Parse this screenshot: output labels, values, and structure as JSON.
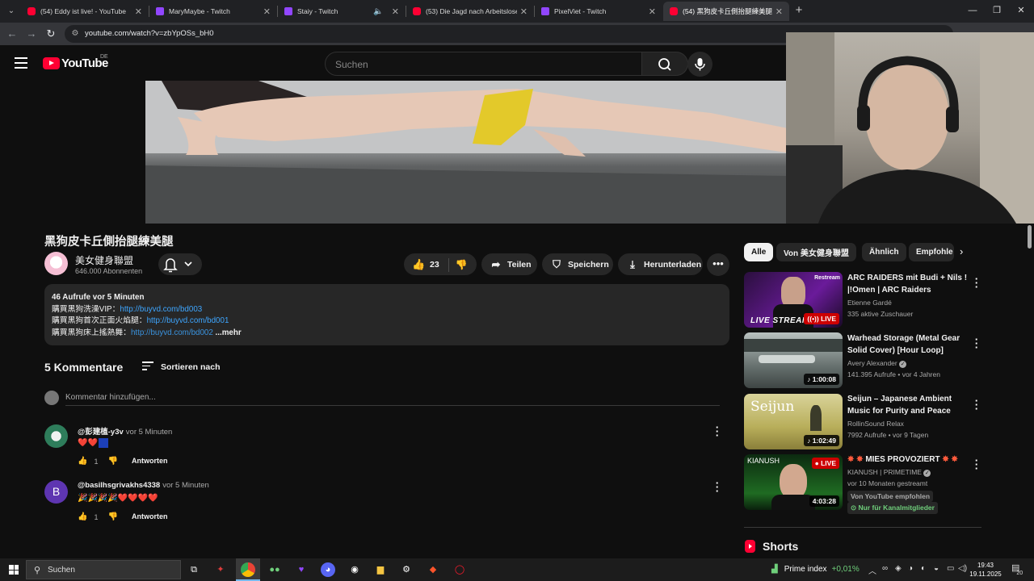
{
  "browser": {
    "tabs": [
      {
        "label": "(54) Eddy ist live! - YouTube",
        "type": "yt",
        "active": false
      },
      {
        "label": "MaryMaybe - Twitch",
        "type": "tw",
        "active": false
      },
      {
        "label": "Staiy - Twitch",
        "type": "tw",
        "active": false,
        "muted": true
      },
      {
        "label": "(53) Die Jagd nach Arbeitslosen",
        "type": "yt",
        "active": false
      },
      {
        "label": "PixelViet - Twitch",
        "type": "tw",
        "active": false
      },
      {
        "label": "(54) 黑狗皮卡丘側抬腿練美腿 -",
        "type": "yt",
        "active": true
      }
    ],
    "url": "youtube.com/watch?v=zbYpOSs_bH0"
  },
  "masthead": {
    "logo_text": "YouTube",
    "country": "DE",
    "search_placeholder": "Suchen"
  },
  "video": {
    "title": "黑狗皮卡丘側抬腿練美腿",
    "channel": "美女健身聯盟",
    "subscribers": "646.000 Abonnenten",
    "likes": "23",
    "share_label": "Teilen",
    "save_label": "Speichern",
    "download_label": "Herunterladen"
  },
  "description": {
    "meta": "46 Aufrufe  vor 5 Minuten",
    "lines": [
      {
        "text": "購買黑狗洗澡VIP：",
        "link": "http://buyvd.com/bd003"
      },
      {
        "text": "購買黑狗首次正面火焰腿：",
        "link": "http://buyvd.com/bd001"
      },
      {
        "text": "購買黑狗床上搖熱舞：",
        "link": "http://buyvd.com/bd002"
      }
    ],
    "more": "...mehr"
  },
  "comments": {
    "header": "5 Kommentare",
    "sort_label": "Sortieren nach",
    "add_placeholder": "Kommentar hinzufügen...",
    "reply_label": "Antworten",
    "items": [
      {
        "author": "@彭建植-y3v",
        "time": "vor 5 Minuten",
        "text": "❤️❤️",
        "likes": "1",
        "avatar_color": "#2e7d5b"
      },
      {
        "author": "@basilhsgrivakhs4338",
        "time": "vor 5 Minuten",
        "text": "🎉🎉🎉🎉❤️❤️❤️❤️",
        "likes": "1",
        "avatar_color": "#5e35b1",
        "avatar_letter": "B"
      }
    ]
  },
  "sidebar": {
    "chips": [
      "Alle",
      "Von 美女健身聯盟",
      "Ähnlich",
      "Empfohle"
    ],
    "recommendations": [
      {
        "title": "ARC RAIDERS mit Budi + Nils ! |!Omen | ARC Raiders",
        "channel": "Etienne Gardé",
        "meta": "335 aktive Zuschauer",
        "badge": "LIVE",
        "thumb_text": "LIVE STREAM",
        "restream": "Restream"
      },
      {
        "title": "Warhead Storage (Metal Gear Solid Cover) [Hour Loop]",
        "channel": "Avery Alexander",
        "meta": "141.395 Aufrufe • vor 4 Jahren",
        "badge": "1:00:08"
      },
      {
        "title": "Seijun – Japanese Ambient Music for Purity and Peace",
        "channel": "RollinSound Relax",
        "meta": "7992 Aufrufe • vor 9 Tagen",
        "badge": "1:02:49",
        "thumb_text": "Seijun"
      },
      {
        "title": "MIES PROVOZIERT",
        "channel": "KIANUSH | PRIMETIME",
        "meta": "vor 10 Monaten gestreamt",
        "badge": "4:03:28",
        "live_badge": "LIVE",
        "thumb_text": "KIANUSH",
        "tag1": "Von YouTube empfohlen",
        "tag2": "Nur für Kanalmitglieder"
      }
    ],
    "shorts_label": "Shorts"
  },
  "taskbar": {
    "search_label": "Suchen",
    "stock_name": "Prime index",
    "stock_change": "+0,01%",
    "time": "19:43",
    "date": "19.11.2025",
    "notif_count": "20"
  },
  "colors": {
    "accent_red": "#ff0033",
    "link_blue": "#3ea6ff",
    "twitch_purple": "#9146ff"
  }
}
